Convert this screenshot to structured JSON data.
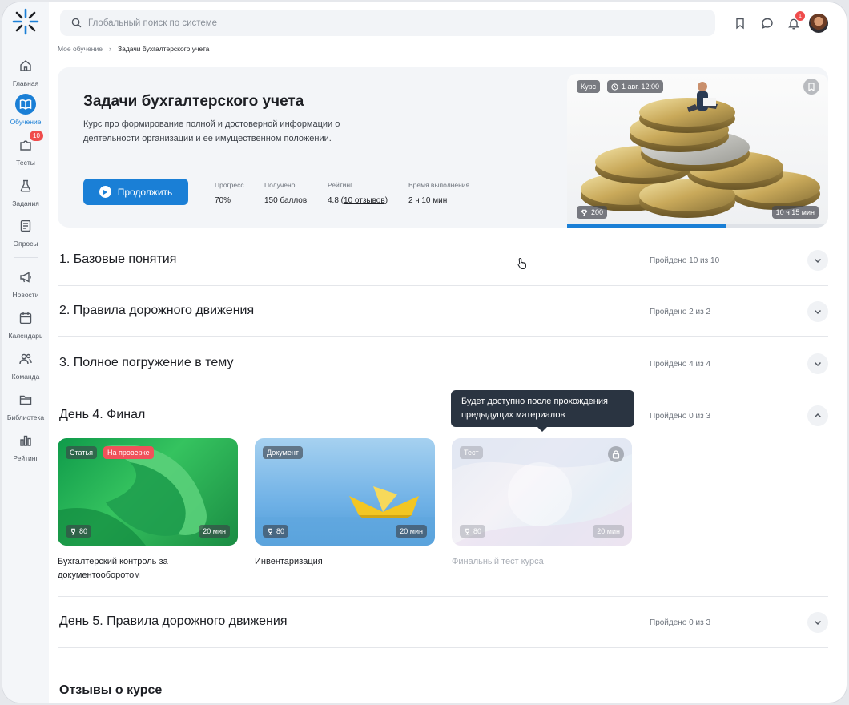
{
  "sidebar": {
    "items": [
      {
        "label": "Главная",
        "icon": "home-icon"
      },
      {
        "label": "Обучение",
        "icon": "book-icon",
        "active": true
      },
      {
        "label": "Тесты",
        "icon": "puzzle-icon",
        "badge": "10"
      },
      {
        "label": "Задания",
        "icon": "flask-icon"
      },
      {
        "label": "Опросы",
        "icon": "survey-icon"
      },
      {
        "label": "Новости",
        "icon": "megaphone-icon"
      },
      {
        "label": "Календарь",
        "icon": "calendar-icon"
      },
      {
        "label": "Команда",
        "icon": "team-icon"
      },
      {
        "label": "Библиотека",
        "icon": "folder-icon"
      },
      {
        "label": "Рейтинг",
        "icon": "rating-icon"
      }
    ]
  },
  "header": {
    "search_placeholder": "Глобальный поиск по системе",
    "notifications_count": "1"
  },
  "breadcrumb": {
    "parent": "Мое обучение",
    "current": "Задачи бухгалтерского учета"
  },
  "course": {
    "title": "Задачи бухгалтерского учета",
    "description": "Курс про формирование полной и достоверной информации о деятельности организации и ее имущественном положении.",
    "continue_label": "Продолжить",
    "stats": {
      "progress_label": "Прогресс",
      "progress_value": "70%",
      "received_label": "Получено",
      "received_value": "150 баллов",
      "rating_label": "Рейтинг",
      "rating_value": "4.8",
      "rating_reviews": "10 отзывов",
      "time_label": "Время выполнения",
      "time_value": "2 ч 10 мин"
    },
    "image": {
      "type_chip": "Курс",
      "date_chip": "1 авг. 12:00",
      "points": "200",
      "duration": "10 ч 15 мин"
    },
    "progress_fraction": 0.61
  },
  "modules": [
    {
      "title": "1. Базовые понятия",
      "status": "Пройдено 10 из 10",
      "expanded": false
    },
    {
      "title": "2. Правила дорожного движения",
      "status": "Пройдено 2 из 2",
      "expanded": false
    },
    {
      "title": "3. Полное погружение в тему",
      "status": "Пройдено 4 из 4",
      "expanded": false
    },
    {
      "title": "День 4. Финал",
      "status": "Пройдено 0 из 3",
      "expanded": true
    },
    {
      "title": "День 5. Правила дорожного движения",
      "status": "Пройдено 0 из 3",
      "expanded": false
    }
  ],
  "lessons": [
    {
      "type": "Статья",
      "status_chip": "На проверке",
      "points": "80",
      "duration": "20 мин",
      "title": "Бухгалтерский контроль за документооборотом"
    },
    {
      "type": "Документ",
      "points": "80",
      "duration": "20 мин",
      "title": "Инвентаризация"
    },
    {
      "type": "Тест",
      "points": "80",
      "duration": "20 мин",
      "title": "Финальный тест курса",
      "locked": true
    }
  ],
  "tooltip": {
    "text": "Будет доступно после прохождения предыдущих материалов"
  },
  "reviews": {
    "title": "Отзывы о курсе"
  },
  "colors": {
    "accent": "#1a7fd6",
    "badge": "#ef4c4c",
    "review_chip": "#f0525a",
    "tooltip_bg": "#2a3441"
  }
}
